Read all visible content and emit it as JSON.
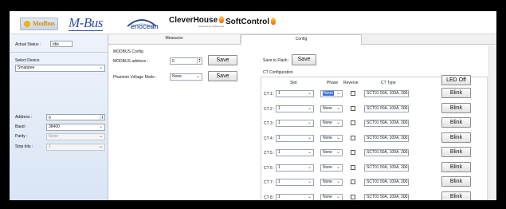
{
  "header": {
    "logos": {
      "modbus": "Modbus",
      "mbus": "M-Bus",
      "enocean": "enocean",
      "cleverhouse": "CleverHouse",
      "cleverhouse_sub": "Powered by SoftControl",
      "softcontrol": "SoftControl"
    }
  },
  "sidebar": {
    "actual_status_label": "Actual Status :",
    "actual_status_value": "Idle",
    "select_device_label": "Select Device",
    "device_value": "Smappee",
    "address_label": "Address :",
    "address_value": "0",
    "baud_label": "Baud :",
    "baud_value": "38400",
    "parity_label": "Parity :",
    "parity_value": "None",
    "stopbits_label": "Stop bits :",
    "stopbits_value": "1"
  },
  "tabs": [
    {
      "label": "Measures",
      "active": false
    },
    {
      "label": "Config",
      "active": true
    }
  ],
  "modbus_config": {
    "title": "MODBUS Config",
    "address_label": "MODBUS address :",
    "address_value": "0",
    "save_label": "Save",
    "phantom_label": "Phantom Voltage Mode :",
    "phantom_value": "None",
    "phantom_save_label": "Save"
  },
  "ct_config": {
    "save_to_flash_label": "Save to Flash :",
    "save_to_flash_button": "Save",
    "title": "CT Configuration",
    "led_off_label": "LED Off",
    "columns": {
      "slot": "Slot",
      "phase": "Phase",
      "reverse": "Reverse",
      "ct_type": "CT Type"
    },
    "rows": [
      {
        "label": "CT 1 :",
        "slot": "1",
        "phase": "None",
        "phase_selected": true,
        "reverse": false,
        "ct_type": "SCT01 50A, 100A, 200.",
        "blink": "Blink"
      },
      {
        "label": "CT 2 :",
        "slot": "1",
        "phase": "None",
        "phase_selected": false,
        "reverse": false,
        "ct_type": "SCT01 50A, 100A, 200.",
        "blink": "Blink"
      },
      {
        "label": "CT 3 :",
        "slot": "1",
        "phase": "None",
        "phase_selected": false,
        "reverse": false,
        "ct_type": "SCT01 50A, 100A, 200.",
        "blink": "Blink"
      },
      {
        "label": "CT 4 :",
        "slot": "1",
        "phase": "None",
        "phase_selected": false,
        "reverse": false,
        "ct_type": "SCT01 50A, 100A, 200.",
        "blink": "Blink"
      },
      {
        "label": "CT 5 :",
        "slot": "1",
        "phase": "None",
        "phase_selected": false,
        "reverse": false,
        "ct_type": "SCT01 50A, 100A, 200.",
        "blink": "Blink"
      },
      {
        "label": "CT 6 :",
        "slot": "1",
        "phase": "None",
        "phase_selected": false,
        "reverse": false,
        "ct_type": "SCT01 50A, 100A, 200.",
        "blink": "Blink"
      },
      {
        "label": "CT 7 :",
        "slot": "1",
        "phase": "None",
        "phase_selected": false,
        "reverse": false,
        "ct_type": "SCT01 50A, 100A, 200.",
        "blink": "Blink"
      },
      {
        "label": "CT 8 :",
        "slot": "1",
        "phase": "None",
        "phase_selected": false,
        "reverse": false,
        "ct_type": "SCT01 50A, 100A, 200.",
        "blink": "Blink"
      }
    ]
  },
  "icons": {
    "dropdown": "chevron-down-icon",
    "spinner": "spinner-arrows-icon",
    "flame": "flame-icon"
  },
  "colors": {
    "sidebar_top": "#eef3fb",
    "sidebar_bottom": "#d9e5f5",
    "mbus_blue": "#2f4ea8",
    "selection_blue": "#3a6fd8"
  }
}
